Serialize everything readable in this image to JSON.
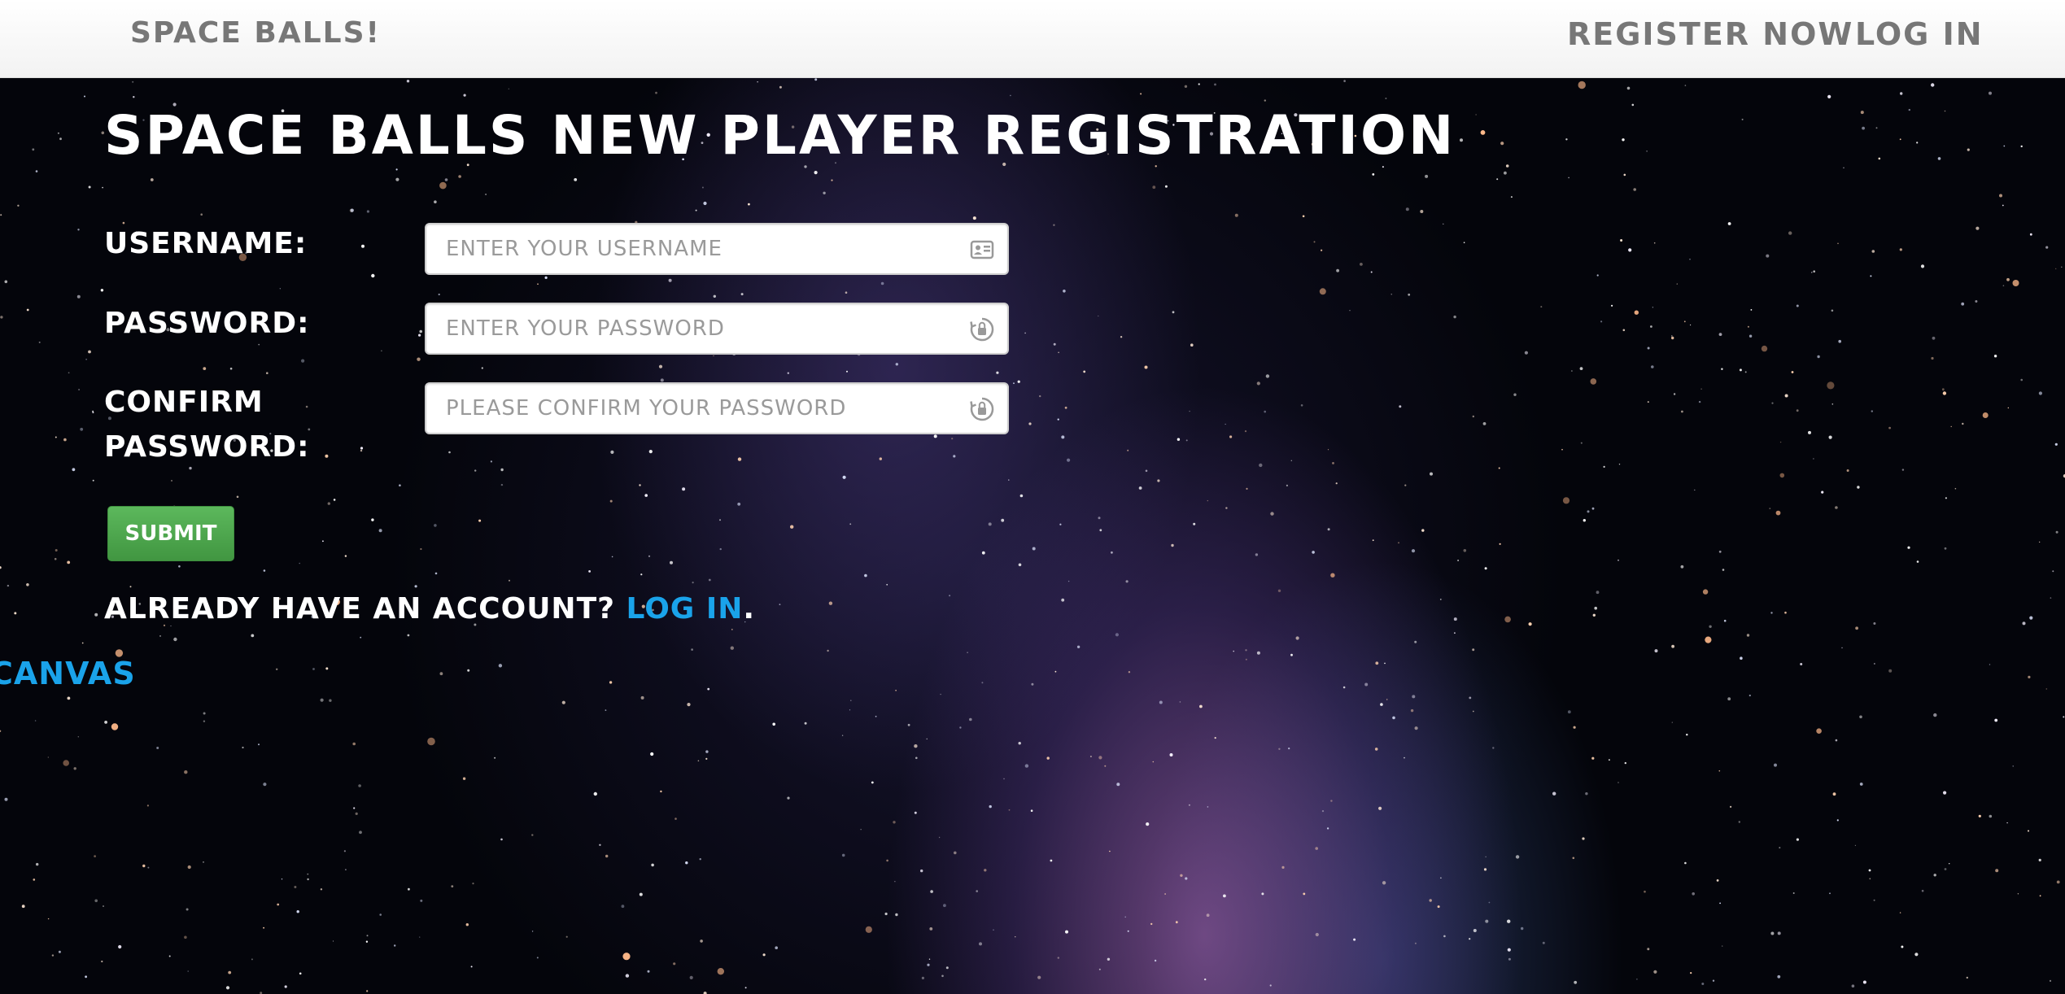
{
  "navbar": {
    "brand": "SPACE BALLS!",
    "register_label": "REGISTER NOW",
    "login_label": "LOG IN"
  },
  "page": {
    "title": "SPACE BALLS NEW PLAYER REGISTRATION"
  },
  "form": {
    "username": {
      "label": "USERNAME:",
      "placeholder": "ENTER YOUR USERNAME",
      "value": "",
      "icon": "id-card-icon"
    },
    "password": {
      "label": "PASSWORD:",
      "placeholder": "ENTER YOUR PASSWORD",
      "value": "",
      "icon": "lock-icon"
    },
    "confirm": {
      "label_line1": "CONFIRM",
      "label_line2": "PASSWORD:",
      "placeholder": "PLEASE CONFIRM YOUR PASSWORD",
      "value": "",
      "icon": "lock-icon"
    },
    "submit_label": "SUBMIT"
  },
  "footer": {
    "account_prompt": "ALREADY HAVE AN ACCOUNT? ",
    "login_link": "LOG IN",
    "period": ".",
    "canvas_link": "CANVAS"
  },
  "colors": {
    "link": "#1aa3ea",
    "submit": "#4cae4c",
    "navbar_text": "#777777",
    "background": "#04050b"
  }
}
